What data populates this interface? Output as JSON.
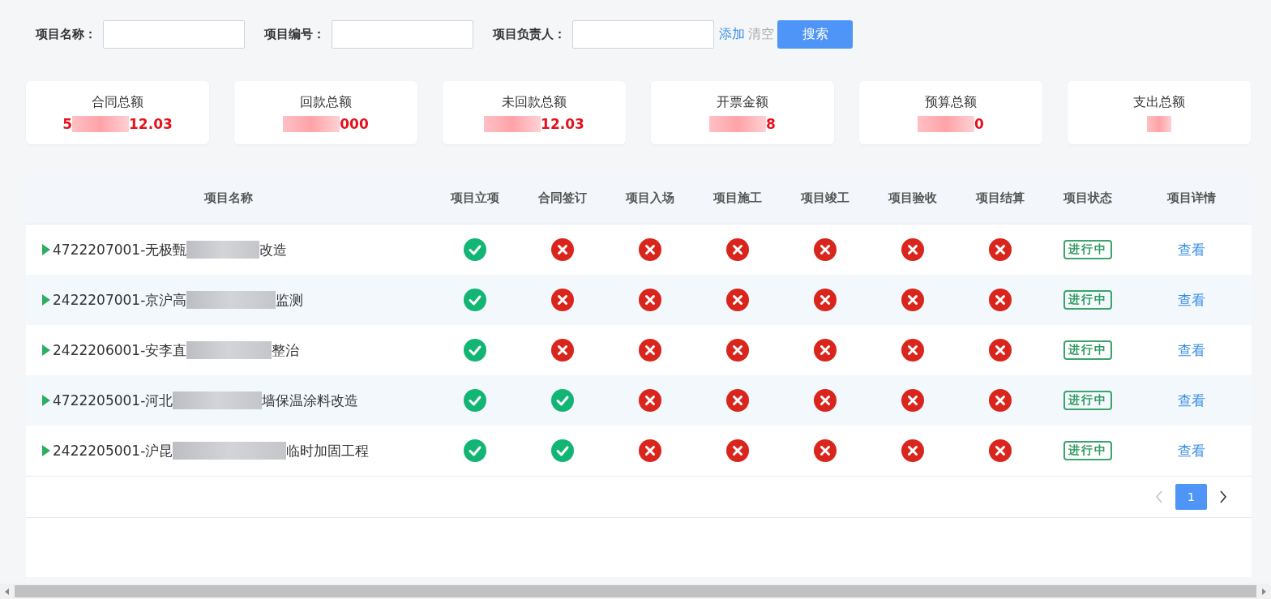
{
  "search": {
    "fields": [
      {
        "label": "项目名称："
      },
      {
        "label": "项目编号："
      },
      {
        "label": "项目负责人："
      }
    ],
    "add_link": "添加",
    "clear_link": "清空",
    "search_button": "搜索"
  },
  "stats": [
    {
      "label": "合同总额",
      "value_start": "5",
      "value_end": "12.03"
    },
    {
      "label": "回款总额",
      "value_end": "000"
    },
    {
      "label": "未回款总额",
      "value_end": "12.03"
    },
    {
      "label": "开票金额",
      "value_end": "8"
    },
    {
      "label": "预算总额",
      "value_end": "0"
    },
    {
      "label": "支出总额"
    }
  ],
  "table": {
    "columns": [
      "项目名称",
      "项目立项",
      "合同签订",
      "项目入场",
      "项目施工",
      "项目竣工",
      "项目验收",
      "项目结算",
      "项目状态",
      "项目详情"
    ],
    "rows": [
      {
        "name_start": "4722207001-无极甄",
        "name_end": "改造",
        "stages": [
          true,
          false,
          false,
          false,
          false,
          false,
          false
        ],
        "status": "进行中",
        "detail": "查看"
      },
      {
        "name_start": "2422207001-京沪高",
        "name_end": "监测",
        "stages": [
          true,
          false,
          false,
          false,
          false,
          false,
          false
        ],
        "status": "进行中",
        "detail": "查看"
      },
      {
        "name_start": "2422206001-安李直",
        "name_end": "整治",
        "stages": [
          true,
          false,
          false,
          false,
          false,
          false,
          false
        ],
        "status": "进行中",
        "detail": "查看"
      },
      {
        "name_start": "4722205001-河北",
        "name_end": "墙保温涂料改造",
        "stages": [
          true,
          true,
          false,
          false,
          false,
          false,
          false
        ],
        "status": "进行中",
        "detail": "查看"
      },
      {
        "name_start": "2422205001-沪昆",
        "name_end": "临时加固工程",
        "stages": [
          true,
          true,
          false,
          false,
          false,
          false,
          false
        ],
        "status": "进行中",
        "detail": "查看"
      }
    ]
  },
  "pagination": {
    "prev_disabled": true,
    "pages": [
      {
        "label": "1",
        "selected": true
      }
    ],
    "next_disabled": false
  }
}
